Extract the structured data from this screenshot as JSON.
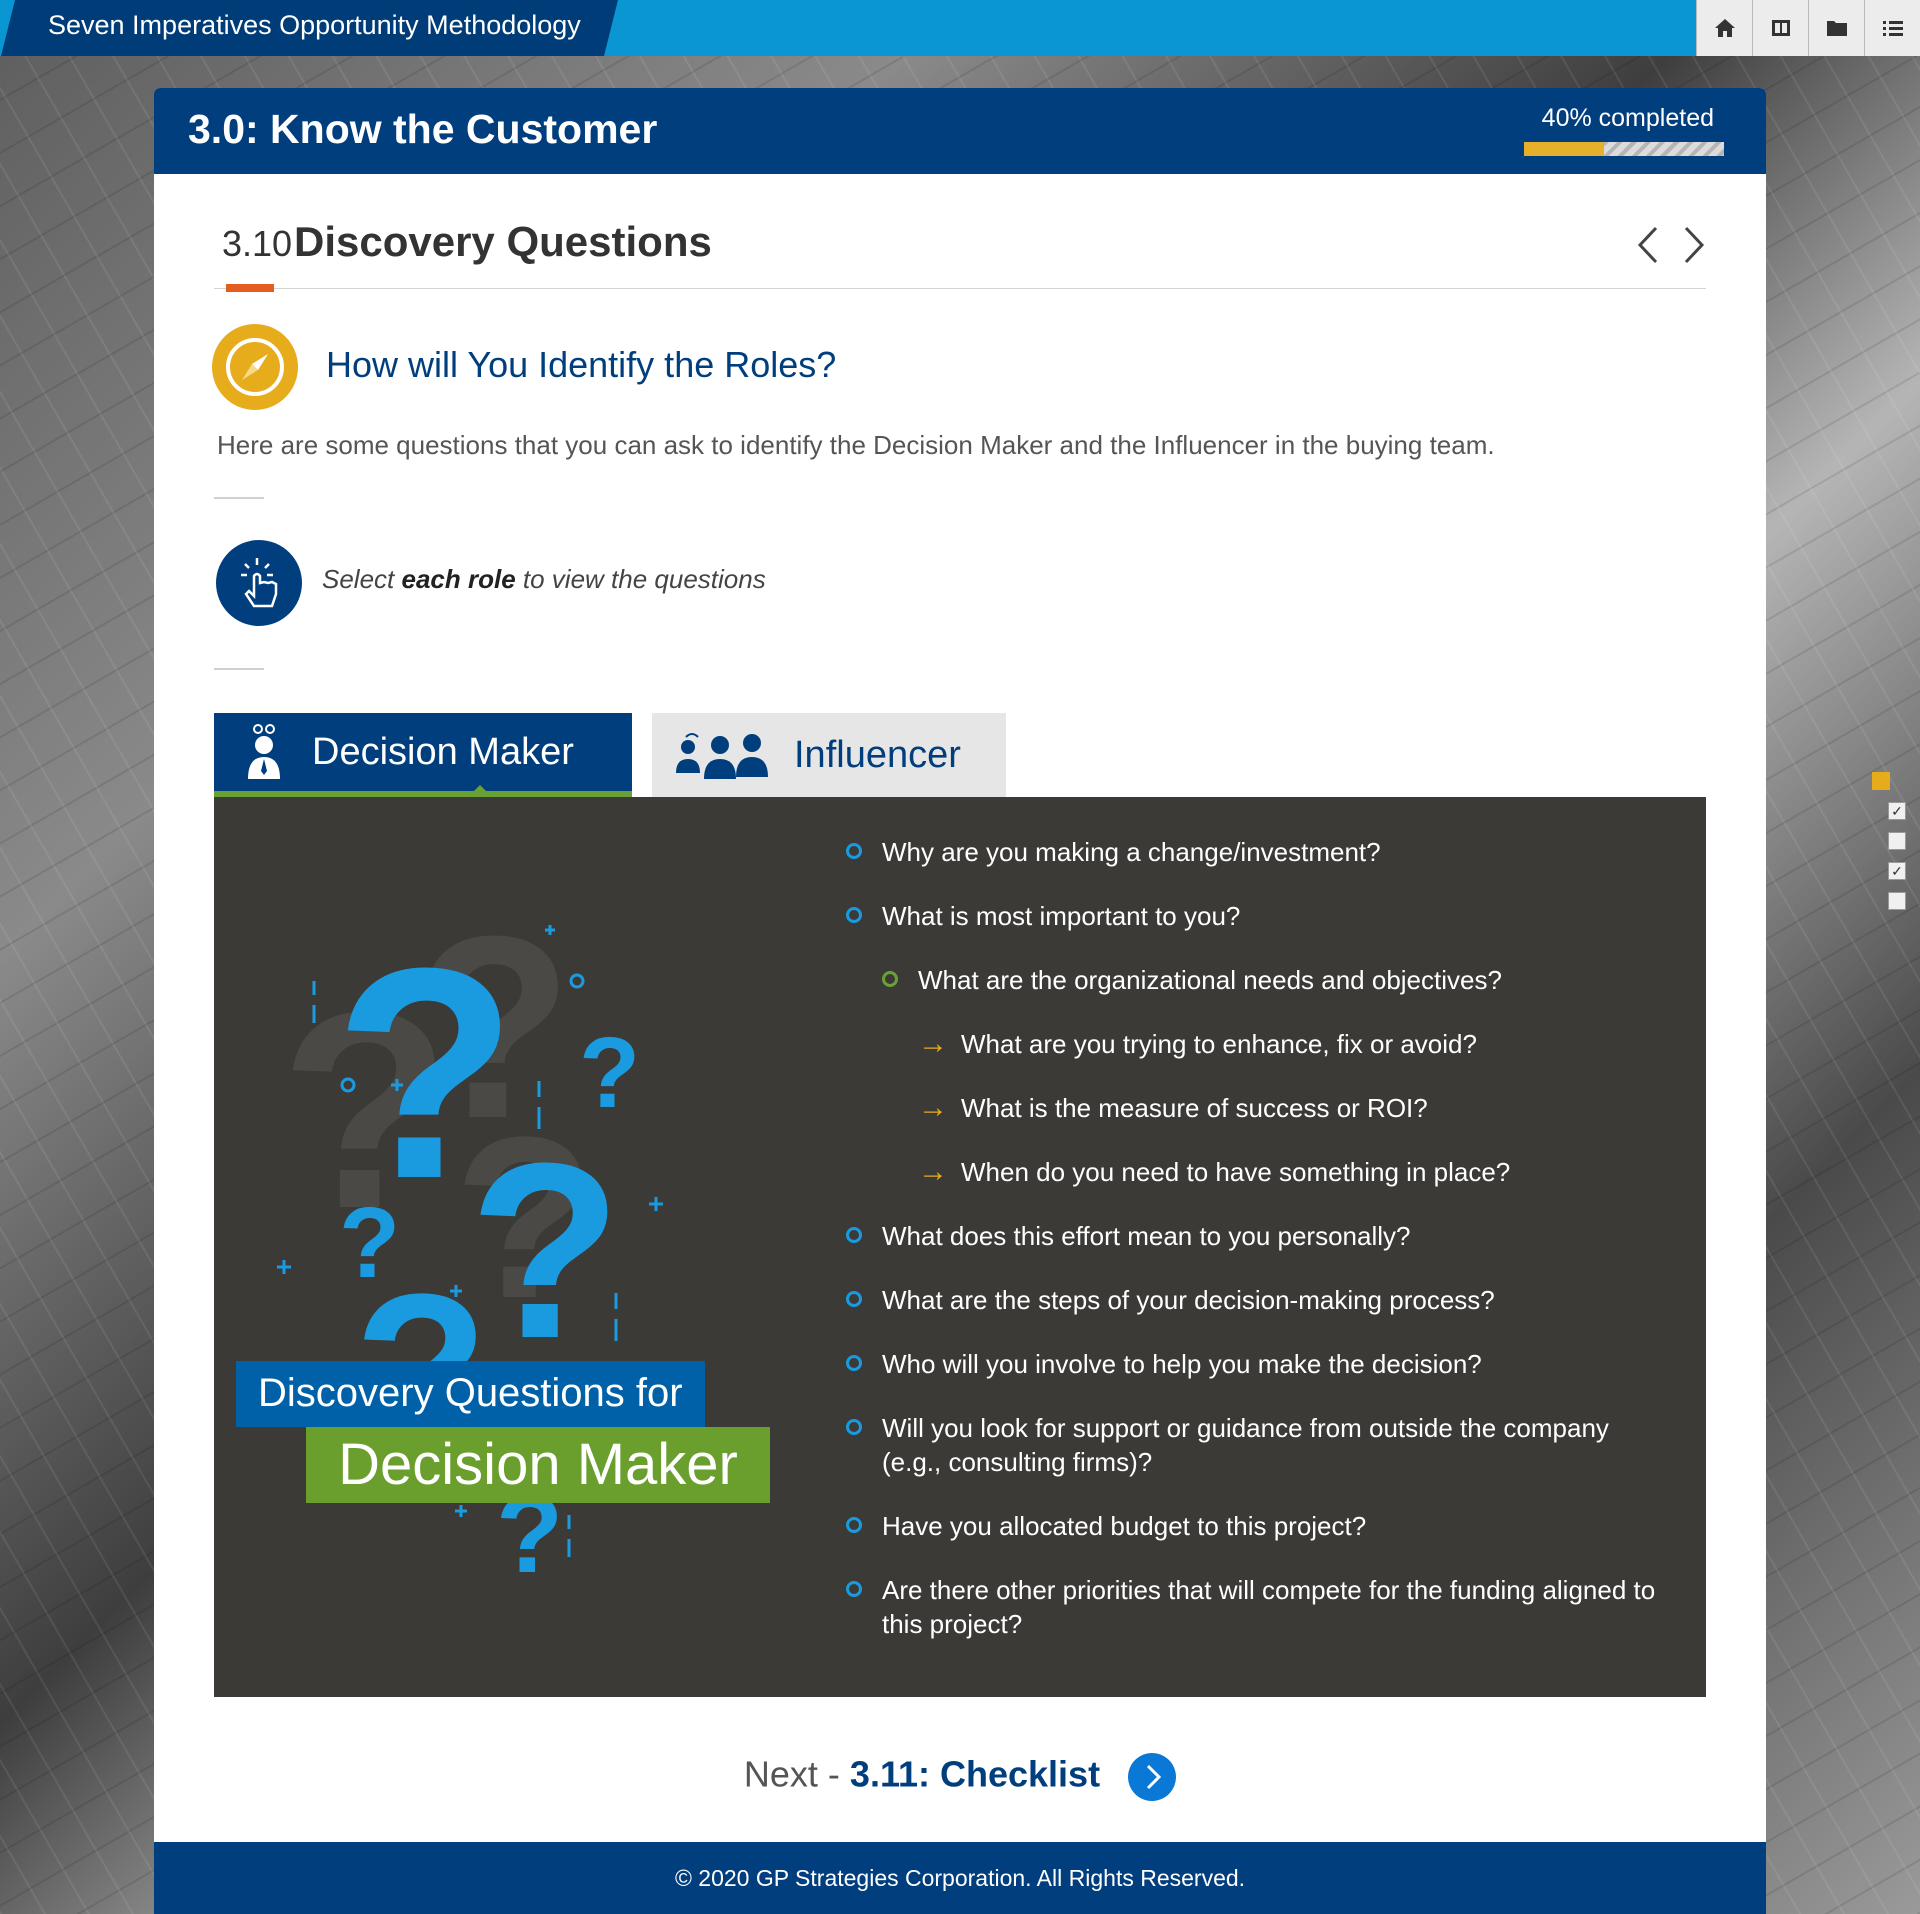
{
  "app": {
    "title": "Seven Imperatives Opportunity Methodology",
    "toolbar": {
      "home_icon": "home-icon",
      "glossary_icon": "book-icon",
      "resources_icon": "folder-icon",
      "menu_icon": "menu-list-icon"
    }
  },
  "module": {
    "title": "3.0: Know the Customer",
    "progress_label": "40% completed",
    "progress_percent": 40
  },
  "section": {
    "number": "3.10",
    "title": "Discovery Questions",
    "heading": "How will You Identify the Roles?",
    "intro": "Here are some questions that you can ask to identify the Decision Maker and the Influencer in the buying team.",
    "instruction_pre": "Select ",
    "instruction_bold": "each role",
    "instruction_post": " to view the questions"
  },
  "tabs": [
    {
      "label": "Decision Maker",
      "active": true
    },
    {
      "label": "Influencer",
      "active": false
    }
  ],
  "panel": {
    "banner_top": "Discovery Questions for",
    "banner_bottom": "Decision Maker",
    "questions": [
      {
        "level": 1,
        "text": "Why are you making a change/investment?"
      },
      {
        "level": 1,
        "text": "What is most important to you?"
      },
      {
        "level": 2,
        "text": "What are the organizational needs and objectives?"
      },
      {
        "level": 3,
        "text": "What are you trying to enhance, fix or avoid?"
      },
      {
        "level": 3,
        "text": "What is the measure of success or ROI?"
      },
      {
        "level": 3,
        "text": "When do you need to have something in place?"
      },
      {
        "level": 1,
        "text": "What does this effort mean to you personally?"
      },
      {
        "level": 1,
        "text": "What are the steps of your decision-making process?"
      },
      {
        "level": 1,
        "text": "Who will you involve to help you make the decision?"
      },
      {
        "level": 1,
        "text": "Will you look for support or guidance from outside the company (e.g., consulting firms)?"
      },
      {
        "level": 1,
        "text": "Have you allocated budget to this project?"
      },
      {
        "level": 1,
        "text": "Are there other priorities that will compete for the funding aligned to this project?"
      }
    ]
  },
  "next": {
    "prefix": "Next - ",
    "target": "3.11: Checklist"
  },
  "footer": {
    "text": "© 2020 GP Strategies Corporation. All Rights Reserved."
  },
  "side_progress": {
    "items": [
      {
        "state": "current"
      },
      {
        "state": "checked",
        "mark": "✓"
      },
      {
        "state": "unchecked",
        "mark": ""
      },
      {
        "state": "checked",
        "mark": "✓"
      },
      {
        "state": "unchecked",
        "mark": ""
      }
    ]
  },
  "colors": {
    "brand_navy": "#003e7e",
    "topbar_blue": "#0a95d3",
    "accent_orange": "#e65c1e",
    "accent_yellow": "#e6ac1c",
    "accent_green": "#6aa135",
    "panel_dark": "#3b3a37"
  }
}
